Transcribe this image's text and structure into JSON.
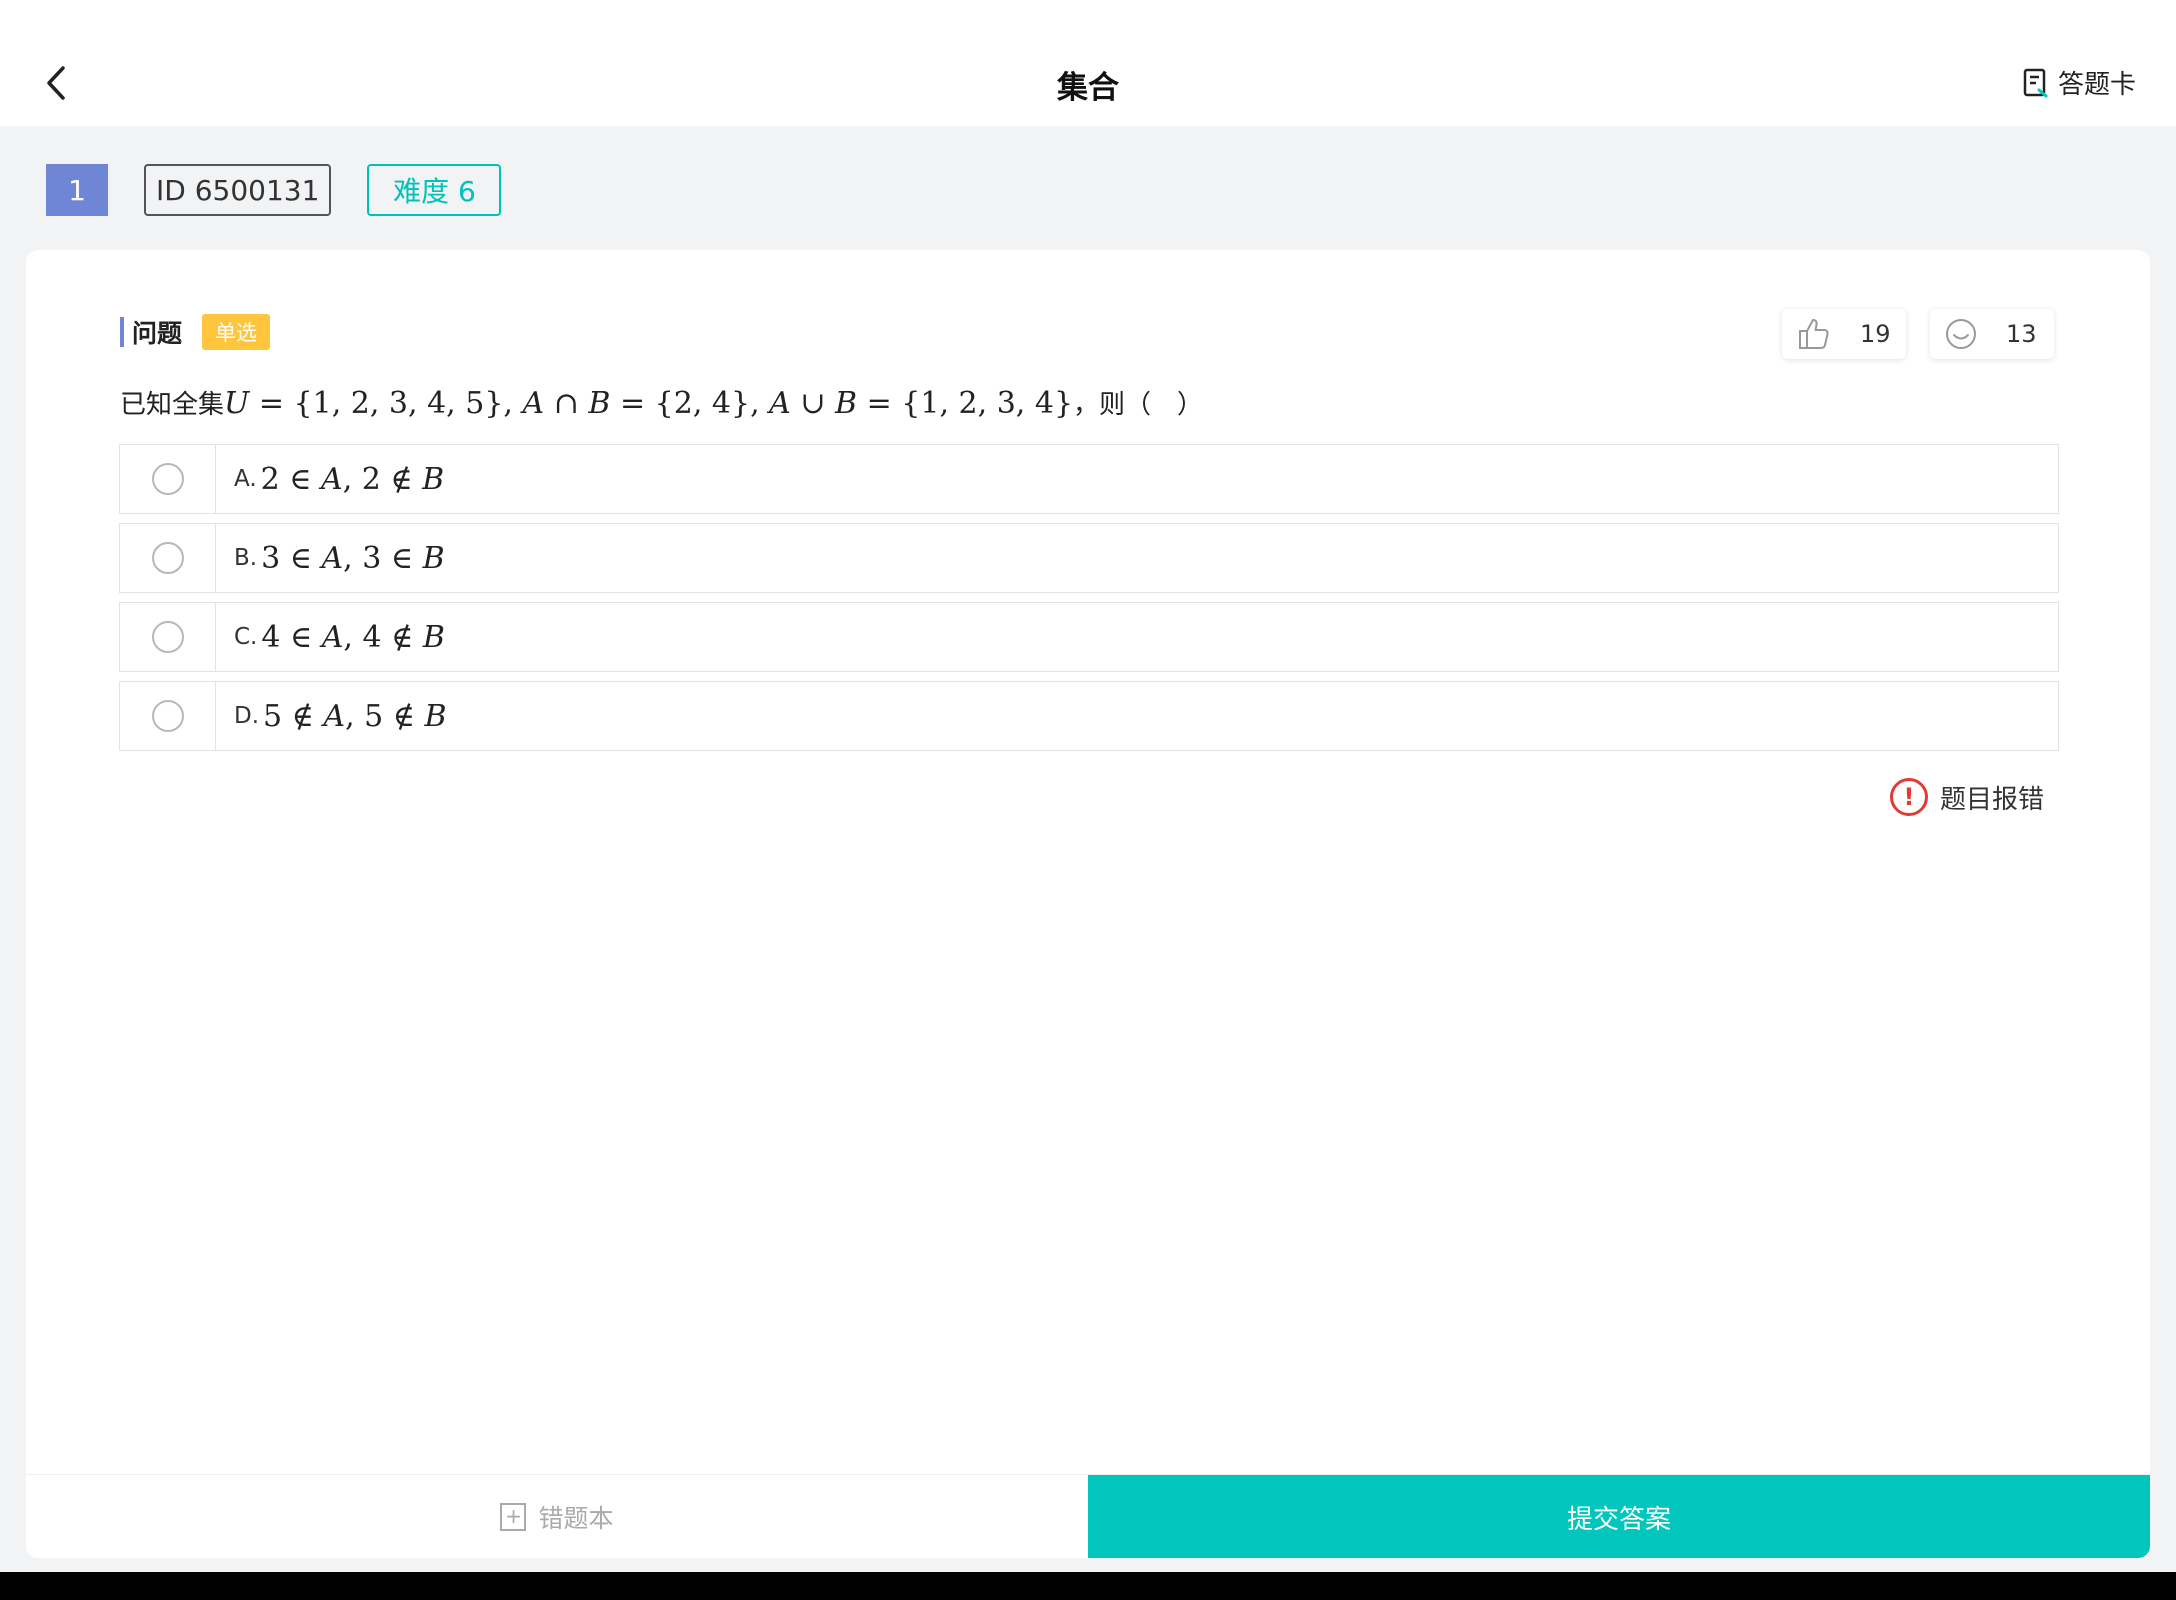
{
  "header": {
    "title": "集合",
    "back_icon": "chevron-left-icon",
    "answer_card_label": "答题卡",
    "answer_card_icon": "answer-sheet-icon"
  },
  "tags": {
    "number": "1",
    "id": "ID 6500131",
    "difficulty": "难度 6"
  },
  "question": {
    "label": "问题",
    "type": "单选",
    "likes": "19",
    "smiles": "13",
    "stem_prefix": "已知全集",
    "stem_suffix": "，则（　）"
  },
  "options": [
    {
      "letter": "A.",
      "selected": false
    },
    {
      "letter": "B.",
      "selected": false
    },
    {
      "letter": "C.",
      "selected": false
    },
    {
      "letter": "D.",
      "selected": false
    }
  ],
  "report": {
    "label": "题目报错"
  },
  "bottom": {
    "wrong_book_label": "错题本",
    "submit_label": "提交答案"
  },
  "colors": {
    "accent_teal": "#00c6bd",
    "tag_blue": "#6f86d6",
    "badge_yellow": "#ffc53d",
    "error_red": "#e53935"
  }
}
